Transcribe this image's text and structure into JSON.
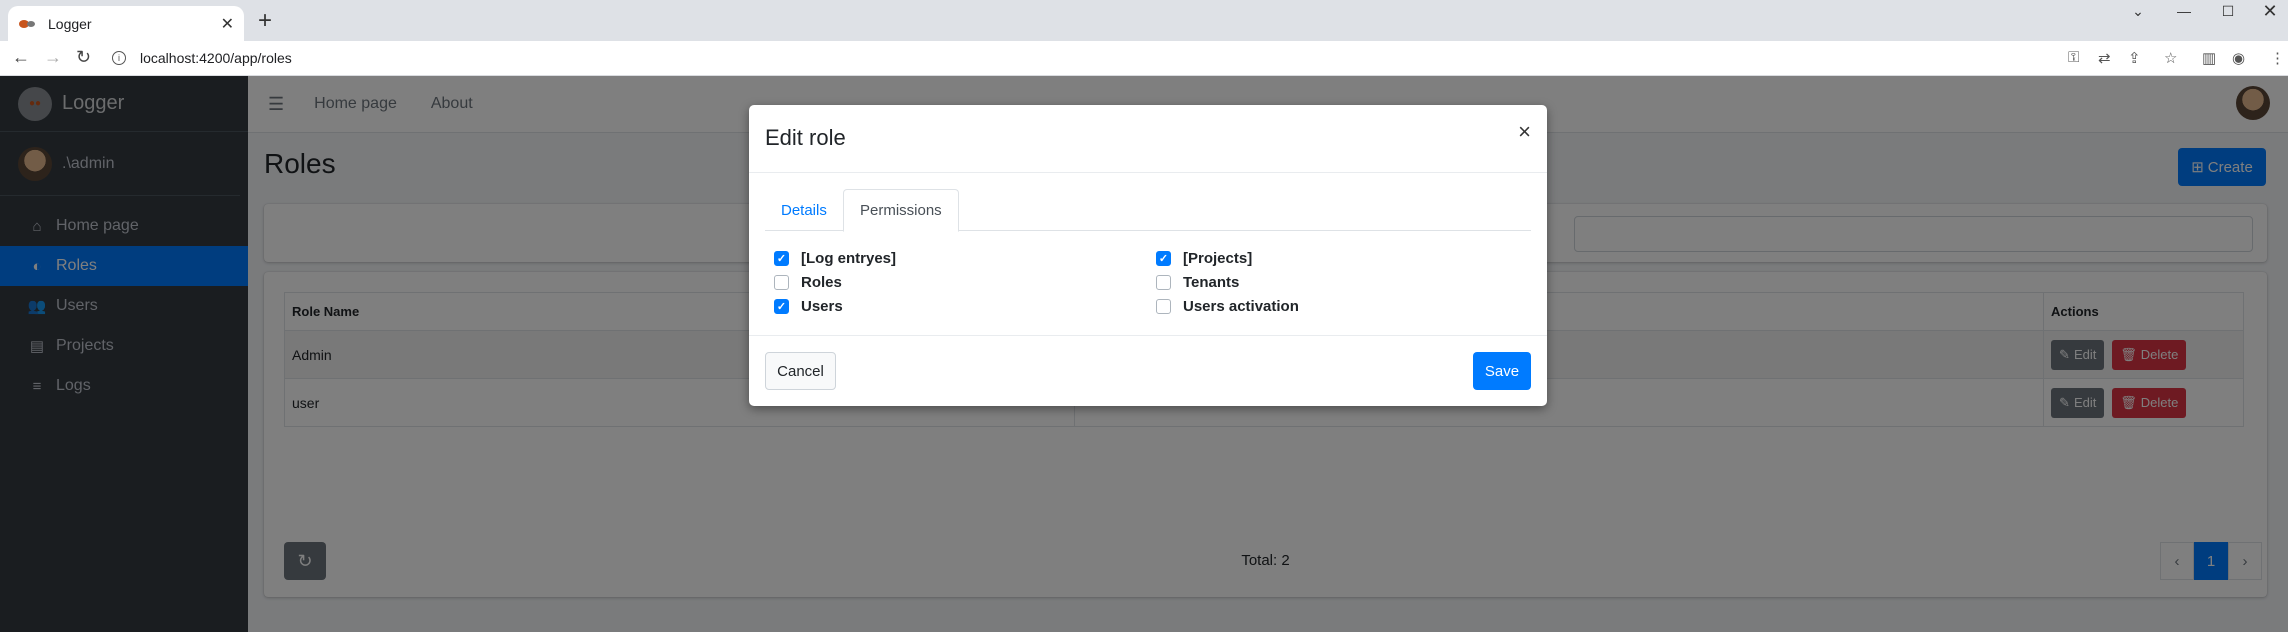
{
  "browser": {
    "tab_title": "Logger",
    "url": "localhost:4200/app/roles"
  },
  "sidebar": {
    "brand": "Logger",
    "user": ".\\admin",
    "items": [
      {
        "label": "Home page",
        "icon": "home-icon"
      },
      {
        "label": "Roles",
        "icon": "roles-icon",
        "active": true
      },
      {
        "label": "Users",
        "icon": "users-icon"
      },
      {
        "label": "Projects",
        "icon": "projects-icon"
      },
      {
        "label": "Logs",
        "icon": "logs-icon"
      }
    ]
  },
  "topnav": {
    "links": [
      "Home page",
      "About"
    ]
  },
  "page": {
    "title": "Roles",
    "create_label": "Create"
  },
  "table": {
    "columns": [
      "Role Name",
      "Actions"
    ],
    "rows": [
      {
        "name": "Admin"
      },
      {
        "name": "user"
      }
    ],
    "edit_label": "Edit",
    "delete_label": "Delete"
  },
  "footer": {
    "total": "Total: 2",
    "current_page": "1"
  },
  "modal": {
    "title": "Edit role",
    "tabs": [
      "Details",
      "Permissions"
    ],
    "active_tab": "Permissions",
    "permissions": [
      {
        "label": "[Log entryes]",
        "checked": true
      },
      {
        "label": "Roles",
        "checked": false
      },
      {
        "label": "Users",
        "checked": true
      },
      {
        "label": "[Projects]",
        "checked": true
      },
      {
        "label": "Tenants",
        "checked": false
      },
      {
        "label": "Users activation",
        "checked": false
      }
    ],
    "cancel_label": "Cancel",
    "save_label": "Save"
  },
  "colors": {
    "primary": "#007bff",
    "danger": "#dc3545",
    "sidebar": "#343a40"
  }
}
